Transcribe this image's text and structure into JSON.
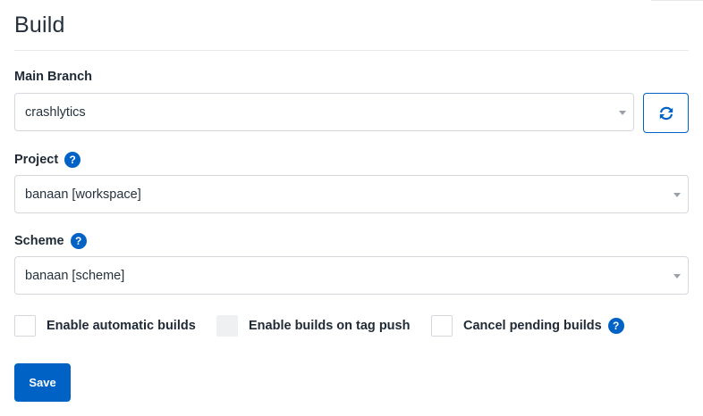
{
  "section": {
    "title": "Build"
  },
  "main_branch": {
    "label": "Main Branch",
    "value": "crashlytics"
  },
  "project": {
    "label": "Project",
    "value": "banaan [workspace]"
  },
  "scheme": {
    "label": "Scheme",
    "value": "banaan [scheme]"
  },
  "help_glyph": "?",
  "options": {
    "automatic_builds": {
      "label": "Enable automatic builds",
      "checked": false,
      "disabled": false
    },
    "tag_push": {
      "label": "Enable builds on tag push",
      "checked": false,
      "disabled": true
    },
    "cancel_pending": {
      "label": "Cancel pending builds",
      "checked": false,
      "disabled": false
    }
  },
  "actions": {
    "save_label": "Save"
  },
  "icons": {
    "refresh": "refresh-icon",
    "help": "question-circle-icon",
    "dropdown": "caret-down-icon"
  },
  "colors": {
    "primary": "#0062c4",
    "border": "#d4d8dc",
    "disabled_fill": "#eef0f1",
    "text": "#1f2a36"
  }
}
